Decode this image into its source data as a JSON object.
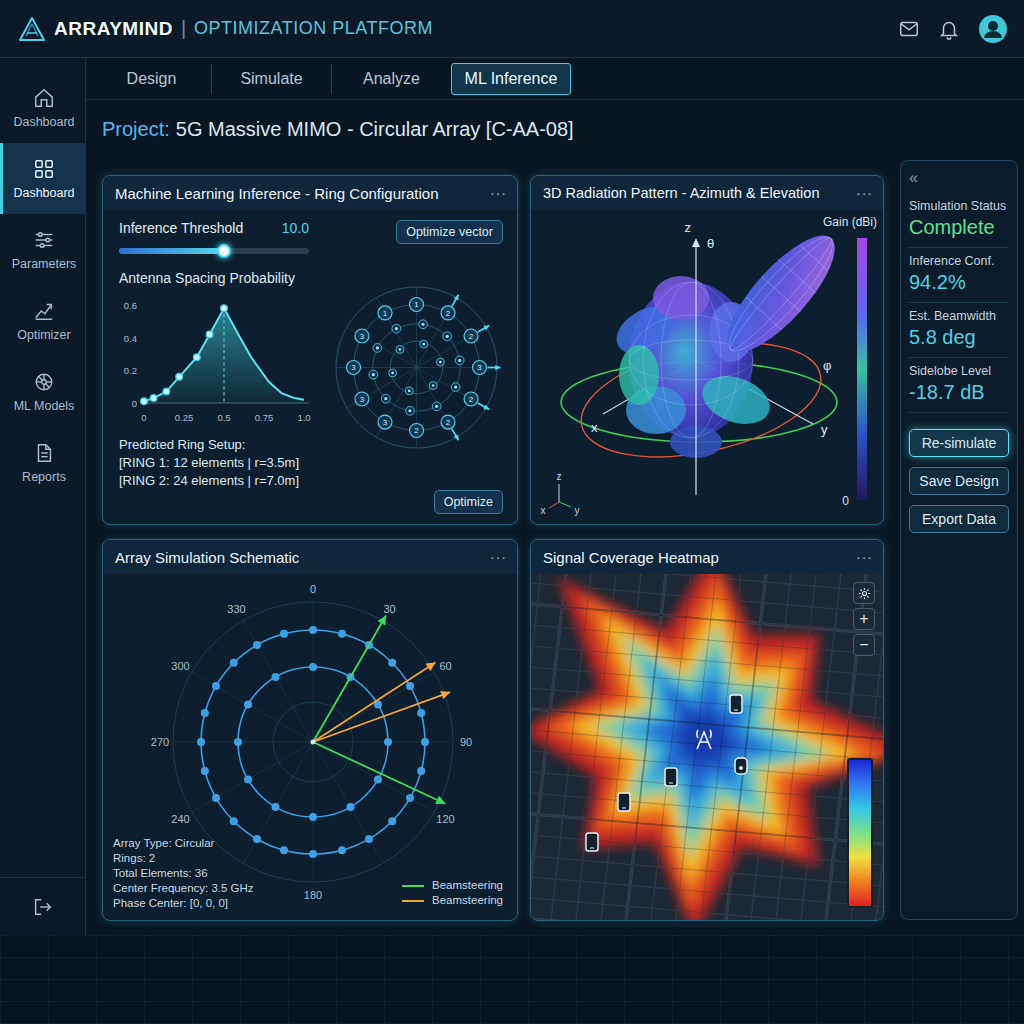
{
  "header": {
    "brand": "ARRAYMIND",
    "separator": "|",
    "subtitle": "OPTIMIZATION PLATFORM"
  },
  "sidebar": {
    "items": [
      {
        "label": "Dashboard",
        "selected": false
      },
      {
        "label": "Dashboard",
        "selected": true
      },
      {
        "label": "Parameters",
        "selected": false
      },
      {
        "label": "Optimizer",
        "selected": false
      },
      {
        "label": "ML Models",
        "selected": false
      },
      {
        "label": "Reports",
        "selected": false
      }
    ]
  },
  "tabs": [
    {
      "label": "Design",
      "selected": false
    },
    {
      "label": "Simulate",
      "selected": false
    },
    {
      "label": "Analyze",
      "selected": false
    },
    {
      "label": "ML Inference",
      "selected": true
    }
  ],
  "project": {
    "prefix": "Project:",
    "name": "5G Massive MIMO - Circular Array [C-AA-08]"
  },
  "ml_panel": {
    "title": "Machine Learning Inference - Ring Configuration",
    "menu": "···",
    "threshold": {
      "label": "Inference Threshold",
      "value": "10.0",
      "level": 0.55
    },
    "optimize_vector": "Optimize vector",
    "chart": {
      "title": "Antenna Spacing Probability",
      "y_ticks": [
        "0.6",
        "0.4",
        "0.2",
        "0"
      ],
      "x_ticks": [
        "0",
        "0.25",
        "0.5",
        "0.75",
        "1.0"
      ],
      "curve": {
        "x": [
          0,
          0.06,
          0.14,
          0.22,
          0.33,
          0.41,
          0.5,
          0.59,
          0.67,
          0.78,
          0.86,
          0.94,
          1.0
        ],
        "y": [
          0.01,
          0.03,
          0.07,
          0.16,
          0.28,
          0.42,
          0.58,
          0.42,
          0.28,
          0.13,
          0.06,
          0.03,
          0.02
        ]
      },
      "points": {
        "x": [
          0,
          0.06,
          0.14,
          0.22,
          0.33,
          0.41,
          0.5
        ],
        "y": [
          0.01,
          0.03,
          0.07,
          0.16,
          0.28,
          0.42,
          0.58
        ]
      }
    },
    "ring_nodes": [
      {
        "label": "1",
        "steered": false
      },
      {
        "label": "2",
        "steered": true
      },
      {
        "label": "2",
        "steered": true
      },
      {
        "label": "3",
        "steered": true
      },
      {
        "label": "2",
        "steered": true
      },
      {
        "label": "2",
        "steered": true
      },
      {
        "label": "2",
        "steered": false
      },
      {
        "label": "3",
        "steered": false
      },
      {
        "label": "3",
        "steered": false
      },
      {
        "label": "3",
        "steered": false
      },
      {
        "label": "3",
        "steered": false
      },
      {
        "label": "1",
        "steered": false
      }
    ],
    "prediction": {
      "title": "Predicted Ring Setup:",
      "lines": [
        "[RING 1: 12 elements | r=3.5m]",
        "[RING 2: 24 elements | r=7.0m]"
      ]
    },
    "optimize": "Optimize"
  },
  "radiation_panel": {
    "title": "3D Radiation Pattern - Azimuth & Elevation",
    "menu": "···",
    "colorbar": {
      "label": "Gain (dBi)",
      "min": "0"
    },
    "axes": {
      "z": "z",
      "theta": "θ",
      "phi": "φ",
      "x": "x",
      "y": "y"
    },
    "triad": {
      "z": "z",
      "x": "x",
      "y": "y"
    }
  },
  "schematic": {
    "title": "Array Simulation Schematic",
    "menu": "···",
    "angle_labels": [
      "0",
      "30",
      "60",
      "90",
      "120",
      "180",
      "240",
      "270",
      "300",
      "330"
    ],
    "rings": [
      {
        "elements": 12
      },
      {
        "elements": 24
      }
    ],
    "beams": [
      {
        "azimuth": 30,
        "color": "#3ddc5a"
      },
      {
        "azimuth": 115,
        "color": "#3ddc5a"
      },
      {
        "azimuth": 57,
        "color": "#f2a33a"
      },
      {
        "azimuth": 70,
        "color": "#f2a33a"
      }
    ],
    "info": [
      "Array Type: Circular",
      "Rings: 2",
      "Total Elements: 36",
      "Center Frequency: 3.5 GHz",
      "Phase Center: [0, 0, 0]"
    ],
    "legend": [
      {
        "label": "Beamsteering",
        "color": "#3ddc5a"
      },
      {
        "label": "Beamsteering",
        "color": "#f2a33a"
      }
    ]
  },
  "heatmap": {
    "title": "Signal Coverage Heatmap",
    "menu": "···",
    "controls": [
      "+",
      "−"
    ]
  },
  "status_panel": {
    "collapse": "«",
    "items": [
      {
        "label": "Simulation Status",
        "value": "Complete",
        "kind": "status"
      },
      {
        "label": "Inference Conf.",
        "value": "94.2%",
        "kind": "metric"
      },
      {
        "label": "Est. Beamwidth",
        "value": "5.8 deg",
        "kind": "metric"
      },
      {
        "label": "Sidelobe Level",
        "value": "-18.7 dB",
        "kind": "metric"
      }
    ],
    "buttons": [
      {
        "label": "Re-simulate",
        "selected": true
      },
      {
        "label": "Save Design",
        "selected": false
      },
      {
        "label": "Export Data",
        "selected": false
      }
    ]
  }
}
